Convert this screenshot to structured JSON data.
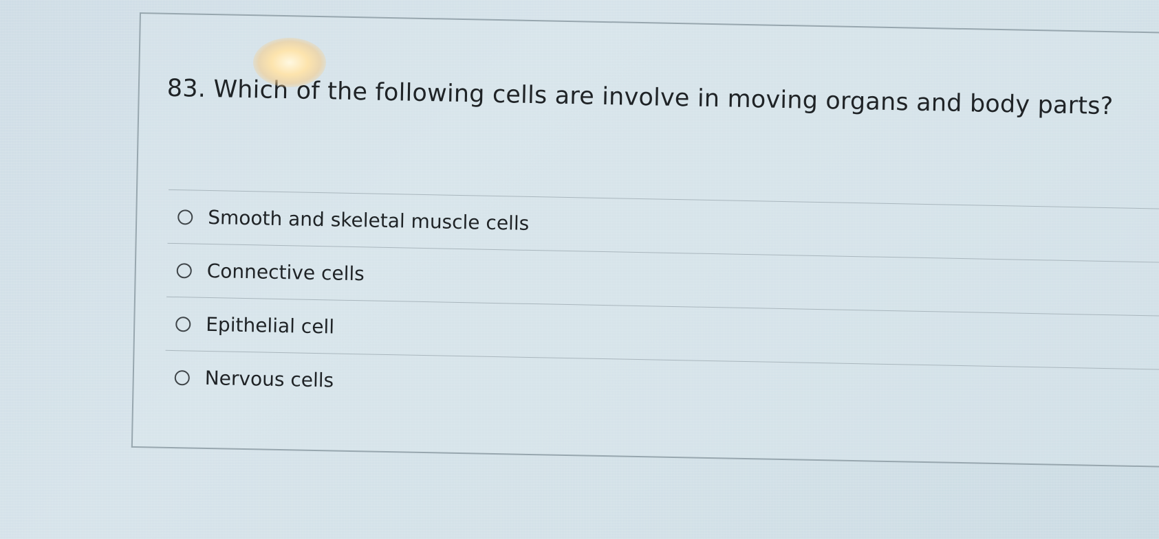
{
  "question": {
    "text": "83. Which of the following cells are involve in moving organs and body parts?"
  },
  "answers": [
    {
      "label": "Smooth and skeletal muscle cells",
      "selected": false
    },
    {
      "label": "Connective cells",
      "selected": false
    },
    {
      "label": "Epithelial cell",
      "selected": false
    },
    {
      "label": "Nervous cells",
      "selected": false
    }
  ]
}
